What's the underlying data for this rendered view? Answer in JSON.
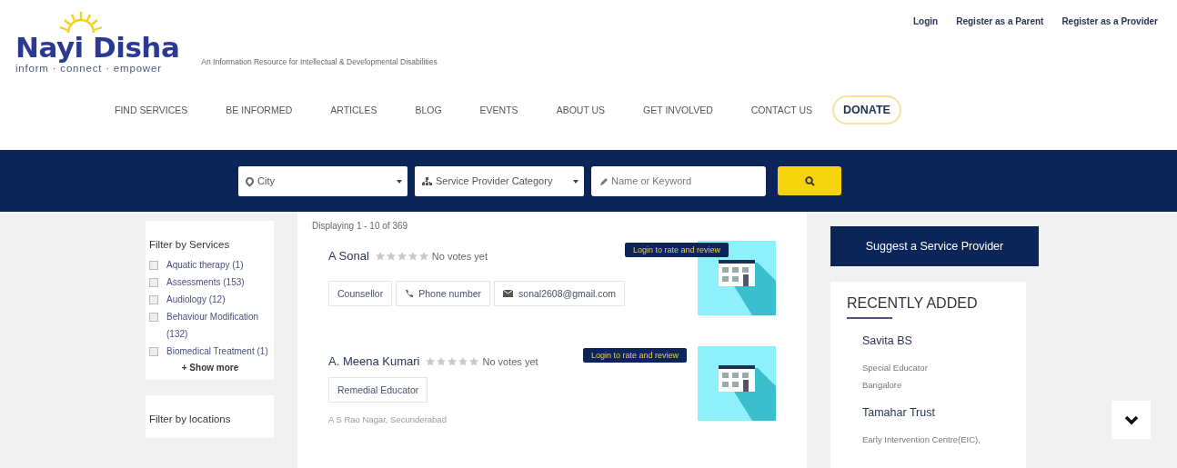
{
  "logo": {
    "name": "Nayi Disha",
    "tagline": "inform · connect · empower"
  },
  "site_description": "An Information Resource for Intellectual & Developmental Disabilities",
  "top_links": [
    "Login",
    "Register as a Parent",
    "Register as a Provider"
  ],
  "nav": [
    {
      "label": "FIND SERVICES",
      "kind": "link"
    },
    {
      "label": "BE INFORMED",
      "kind": "link"
    },
    {
      "label": "ARTICLES",
      "kind": "link"
    },
    {
      "label": "BLOG",
      "kind": "link"
    },
    {
      "label": "EVENTS",
      "kind": "link"
    },
    {
      "label": "ABOUT US",
      "kind": "link"
    },
    {
      "label": "GET INVOLVED",
      "kind": "link"
    },
    {
      "label": "CONTACT US",
      "kind": "link"
    },
    {
      "label": "DONATE",
      "kind": "donate"
    }
  ],
  "search": {
    "city": "City",
    "category": "Service Provider Category",
    "keyword_placeholder": "Name or Keyword"
  },
  "filters": [
    {
      "title": "Filter by Services",
      "options": [
        {
          "label": "Aquatic therapy (1)",
          "checked": false
        },
        {
          "label": "Assessments (153)",
          "checked": false
        },
        {
          "label": "Audiology (12)",
          "checked": false
        },
        {
          "label": "Behaviour Modification (132)",
          "checked": false
        },
        {
          "label": "Biomedical Treatment (1)",
          "checked": false
        }
      ],
      "more": "+ Show more"
    },
    {
      "title": "Filter by locations"
    }
  ],
  "results": {
    "summary": "Displaying 1 - 10 of 369",
    "items": [
      {
        "name": "A Sonal",
        "rate_label": "Login to rate and review",
        "stars": 0,
        "votes": "No votes yet",
        "tags": [
          {
            "kind": "plain",
            "text": "Counsellor"
          },
          {
            "kind": "phone",
            "text": "Phone number"
          },
          {
            "kind": "email",
            "text": "sonal2608@gmail.com"
          }
        ]
      },
      {
        "name": "A. Meena Kumari",
        "rate_label": "Login to rate and review",
        "stars": 0,
        "votes": "No votes yet",
        "tags": [
          {
            "kind": "plain",
            "text": "Remedial Educator"
          }
        ],
        "address": "A S Rao Nagar, Secunderabad"
      }
    ]
  },
  "suggest_button": "Suggest a Service Provider",
  "recently_added": {
    "title": "RECENTLY ADDED",
    "items": [
      {
        "name": "Savita BS",
        "lines": [
          "Special Educator",
          "Bangalore"
        ]
      },
      {
        "name": "Tamahar Trust",
        "lines": [
          "Early Intervention Centre(EIC),"
        ]
      }
    ]
  }
}
